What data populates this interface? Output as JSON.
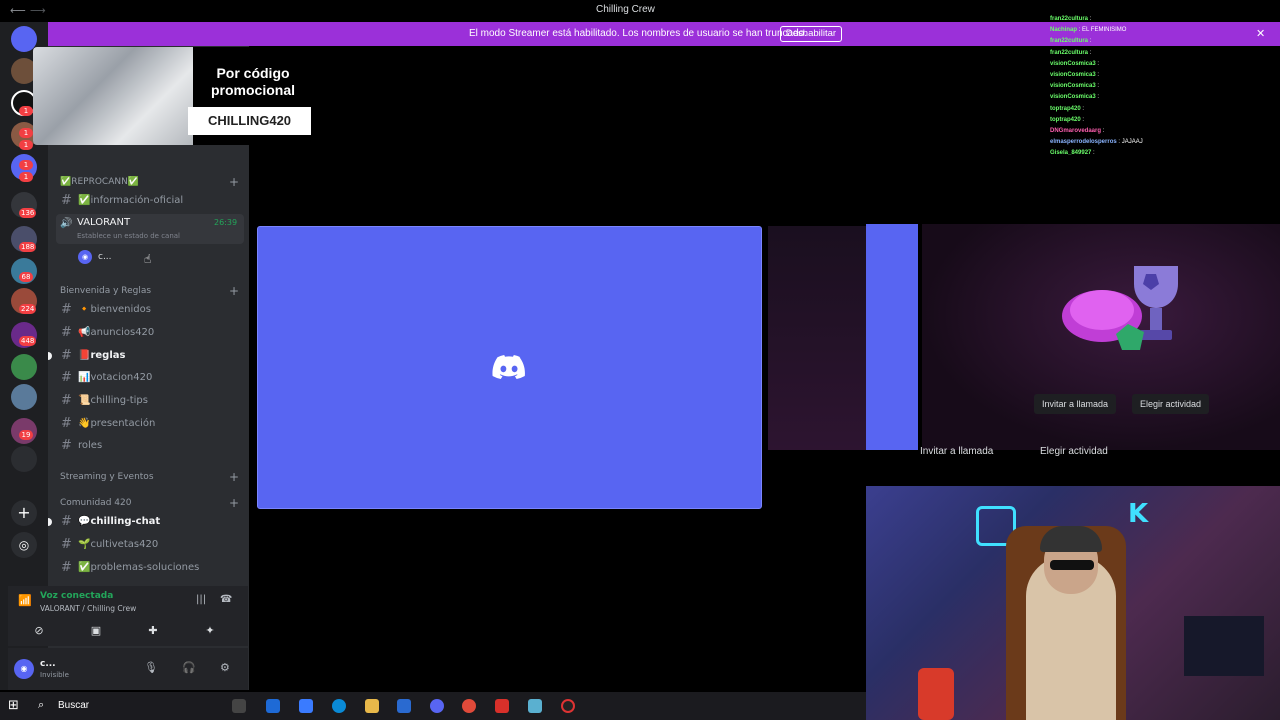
{
  "window": {
    "title": "Chilling Crew",
    "back_icon": "arrow-left-icon",
    "forward_icon": "arrow-right-icon"
  },
  "banner": {
    "message": "El modo Streamer está habilitado. Los nombres de usuario se han truncado.",
    "button": "Deshabilitar",
    "close_icon": "close-icon"
  },
  "promo": {
    "heading": "Por código promocional",
    "code": "CHILLING420"
  },
  "rail": {
    "badges": [
      "1",
      "1",
      "1",
      "1",
      "1",
      "136",
      "188",
      "68",
      "224",
      "448",
      "19"
    ],
    "add_icon": "plus-icon",
    "discover_icon": "compass-icon"
  },
  "sidebar": {
    "categories": {
      "reprocann": "✅REPROCANN✅",
      "bienvenida": "Bienvenida y Reglas",
      "streaming": "Streaming y Eventos",
      "comunidad": "Comunidad 420"
    },
    "channels": {
      "informacion": "✅información-oficial",
      "bienvenidos": "🔸bienvenidos",
      "anuncios": "📢anuncios420",
      "reglas": "📕reglas",
      "votacion": "📊votacion420",
      "chilling_tips": "📜chilling-tips",
      "presentacion": "👋presentación",
      "roles": "roles",
      "chilling_chat": "💬chilling-chat",
      "cultivetas": "🌱cultivetas420",
      "problemas": "✅problemas-soluciones"
    },
    "voice_channel": {
      "name": "VALORANT",
      "status": "Establece un estado de canal",
      "time": "26:39"
    },
    "voice_user": {
      "name": "c..."
    }
  },
  "voice_panel": {
    "status": "Voz conectada",
    "channel": "VALORANT / Chilling Crew"
  },
  "user_panel": {
    "name": "c...",
    "status": "Invisible"
  },
  "activity": {
    "invite": "Invitar a llamada",
    "choose": "Elegir actividad"
  },
  "chat": [
    {
      "user": "fran22cultura",
      "text": ":"
    },
    {
      "user": "Nachinap",
      "text": ": EL FEMINISIMO"
    },
    {
      "user": "fran22cultura",
      "text": ":"
    },
    {
      "user": "fran22cultura",
      "text": ":"
    },
    {
      "user": "visionCosmica3",
      "text": ":"
    },
    {
      "user": "visionCosmica3",
      "text": ":"
    },
    {
      "user": "visionCosmica3",
      "text": ":"
    },
    {
      "user": "visionCosmica3",
      "text": ":"
    },
    {
      "user": "toptrap420",
      "text": ":"
    },
    {
      "user": "toptrap420",
      "text": ":"
    },
    {
      "user": "DNGmarovedaarg",
      "text": ":"
    },
    {
      "user": "elmasperrodelosperros",
      "text": ": JAJAAJ"
    },
    {
      "user": "Gisela_849927",
      "text": ":"
    }
  ],
  "taskbar": {
    "search": "Buscar",
    "start_icon": "windows-icon",
    "search_icon": "search-icon"
  },
  "colors": {
    "blurple": "#5865f2",
    "banner": "#9b30d9",
    "online": "#23a55a"
  }
}
